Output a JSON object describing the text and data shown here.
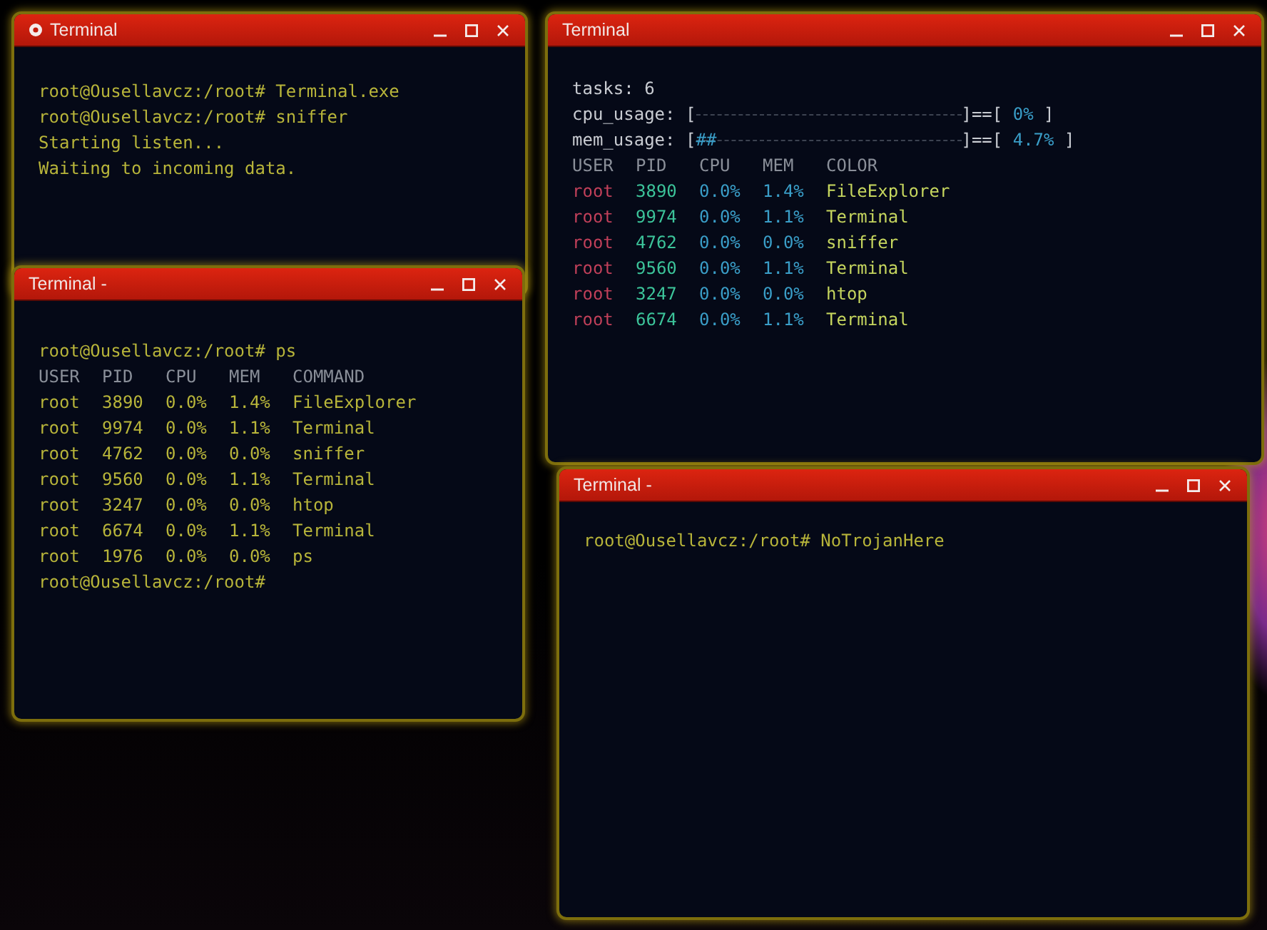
{
  "windows": [
    {
      "title": "Terminal",
      "app_icon": true,
      "kind": "shell",
      "blocks": [
        {
          "kind": "text",
          "lines": [
            "root@Ousellavcz:/root# Terminal.exe",
            "root@Ousellavcz:/root# sniffer",
            "Starting listen...",
            "Waiting to incoming data."
          ]
        }
      ]
    },
    {
      "title": "Terminal -",
      "app_icon": false,
      "kind": "shell",
      "blocks": [
        {
          "kind": "text",
          "lines": [
            "root@Ousellavcz:/root# ps"
          ]
        },
        {
          "kind": "table",
          "columns": [
            {
              "label": "USER"
            },
            {
              "label": "PID"
            },
            {
              "label": "CPU"
            },
            {
              "label": "MEM"
            },
            {
              "label": "COMMAND"
            }
          ],
          "rows": [
            [
              "root",
              "3890",
              "0.0%",
              "1.4%",
              "FileExplorer"
            ],
            [
              "root",
              "9974",
              "0.0%",
              "1.1%",
              "Terminal"
            ],
            [
              "root",
              "4762",
              "0.0%",
              "0.0%",
              "sniffer"
            ],
            [
              "root",
              "9560",
              "0.0%",
              "1.1%",
              "Terminal"
            ],
            [
              "root",
              "3247",
              "0.0%",
              "0.0%",
              "htop"
            ],
            [
              "root",
              "6674",
              "0.0%",
              "1.1%",
              "Terminal"
            ],
            [
              "root",
              "1976",
              "0.0%",
              "0.0%",
              "ps"
            ]
          ]
        },
        {
          "kind": "text",
          "lines": [
            "root@Ousellavcz:/root#"
          ]
        }
      ]
    },
    {
      "title": "Terminal",
      "app_icon": false,
      "kind": "monitor",
      "blocks": [
        {
          "kind": "text",
          "lines": [
            "tasks: 6"
          ]
        },
        {
          "kind": "meter",
          "label": "cpu_usage:",
          "open": "[",
          "close": "]==[",
          "reading": "0%",
          "end": "]"
        },
        {
          "kind": "meter",
          "label": "mem_usage:",
          "open": "[",
          "fill": "##",
          "close": "]==[",
          "reading": "4.7%",
          "end": "]",
          "level": 0.047
        },
        {
          "kind": "table",
          "columns": [
            {
              "label": "USER",
              "color": "#c2405a"
            },
            {
              "label": "PID",
              "color": "#3cc49a"
            },
            {
              "label": "CPU",
              "color": "#3a9ec8"
            },
            {
              "label": "MEM",
              "color": "#3a9ec8"
            },
            {
              "label": "COLOR",
              "color": "#c6d65e"
            }
          ],
          "rows": [
            [
              "root",
              "3890",
              "0.0%",
              "1.4%",
              "FileExplorer"
            ],
            [
              "root",
              "9974",
              "0.0%",
              "1.1%",
              "Terminal"
            ],
            [
              "root",
              "4762",
              "0.0%",
              "0.0%",
              "sniffer"
            ],
            [
              "root",
              "9560",
              "0.0%",
              "1.1%",
              "Terminal"
            ],
            [
              "root",
              "3247",
              "0.0%",
              "0.0%",
              "htop"
            ],
            [
              "root",
              "6674",
              "0.0%",
              "1.1%",
              "Terminal"
            ]
          ]
        }
      ]
    },
    {
      "title": "Terminal -",
      "app_icon": false,
      "kind": "shell",
      "blocks": [
        {
          "kind": "text",
          "lines": [
            "root@Ousellavcz:/root# NoTrojanHere"
          ]
        }
      ]
    }
  ]
}
